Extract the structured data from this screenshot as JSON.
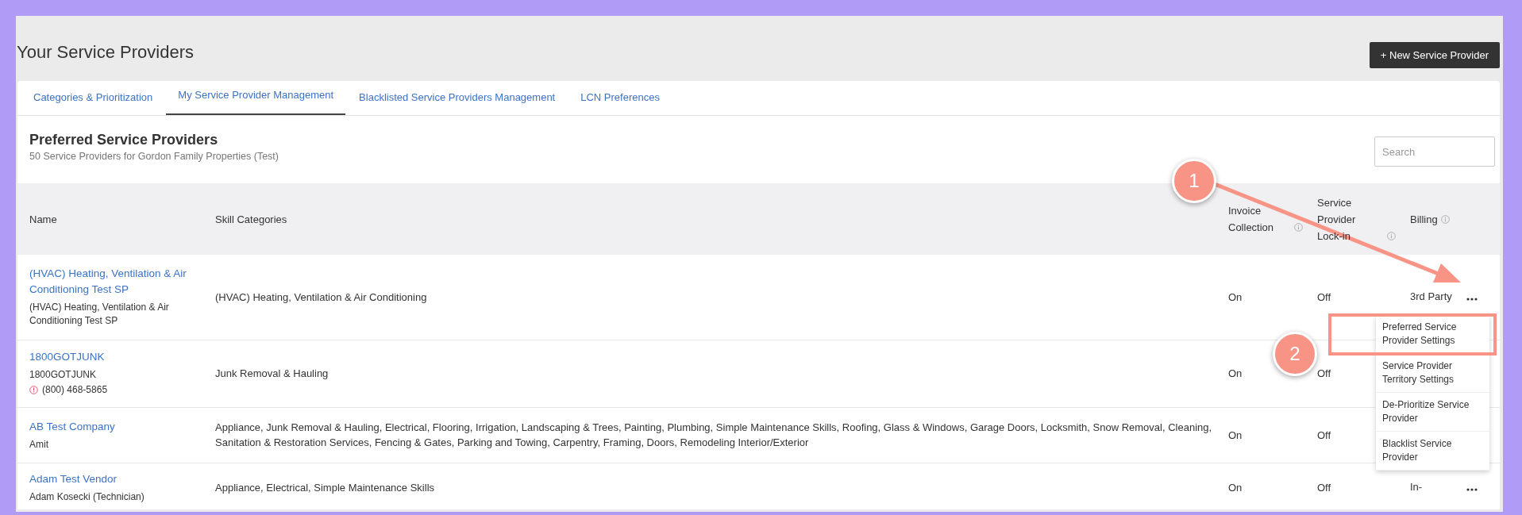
{
  "page": {
    "title": "Your Service Providers",
    "new_button": "+ New Service Provider"
  },
  "tabs": [
    {
      "label": "Categories & Prioritization",
      "selected": false
    },
    {
      "label": "My Service Provider Management",
      "selected": true
    },
    {
      "label": "Blacklisted Service Providers Management",
      "selected": false
    },
    {
      "label": "LCN Preferences",
      "selected": false
    }
  ],
  "section": {
    "title": "Preferred Service Providers",
    "subtitle": "50 Service Providers for Gordon Family Properties (Test)",
    "search": {
      "placeholder": "Search"
    }
  },
  "table": {
    "columns": [
      {
        "label": "Name",
        "kind": "plain"
      },
      {
        "label": "Skill Categories",
        "kind": "plain"
      },
      {
        "label": "Invoice Collection",
        "kind": "with_info"
      },
      {
        "label": "Service Provider Lock-in",
        "kind": "with_info"
      },
      {
        "label": "Billing",
        "kind": "with_info"
      }
    ],
    "rows": [
      {
        "name": "(HVAC) Heating, Ventilation & Air Conditioning Test SP",
        "details": [
          {
            "kind": "contact",
            "text": "(HVAC) Heating, Ventilation & Air Conditioning Test SP"
          }
        ],
        "skills": "(HVAC) Heating, Ventilation & Air Conditioning",
        "invoice": "On",
        "lock_in": "Off",
        "billing": "3rd Party",
        "menu": {
          "items": [
            {
              "label": "Preferred Service Provider Settings",
              "highlighted": true
            },
            {
              "label": "Service Provider Territory Settings",
              "highlighted": false
            },
            {
              "label": "De-Prioritize Service Provider",
              "highlighted": false
            },
            {
              "label": "Blacklist Service Provider",
              "highlighted": false
            }
          ]
        }
      },
      {
        "name": "1800GOTJUNK",
        "details": [
          {
            "kind": "contact",
            "text": "1800GOTJUNK"
          },
          {
            "kind": "phone_alert",
            "text": "(800) 468-5865"
          }
        ],
        "skills": "Junk Removal & Hauling",
        "invoice": "On",
        "lock_in": "Off"
      },
      {
        "name": "AB Test Company",
        "details": [
          {
            "kind": "contact",
            "text": "Amit"
          }
        ],
        "skills": "Appliance, Junk Removal & Hauling, Electrical, Flooring, Irrigation, Landscaping & Trees, Painting, Plumbing, Simple Maintenance Skills, Roofing, Glass & Windows, Garage Doors, Locksmith, Snow Removal, Cleaning, Sanitation & Restoration Services, Fencing & Gates, Parking and Towing, Carpentry, Framing, Doors, Remodeling Interior/Exterior",
        "invoice": "On",
        "lock_in": "Off"
      },
      {
        "name": "Adam Test Vendor",
        "details": [
          {
            "kind": "contact",
            "text": "Adam Kosecki (Technician)"
          }
        ],
        "skills": "Appliance, Electrical, Simple Maintenance Skills",
        "invoice": "On",
        "lock_in": "Off",
        "billing": "In-"
      }
    ]
  },
  "annotations": [
    {
      "label": "1"
    },
    {
      "label": "2"
    }
  ]
}
